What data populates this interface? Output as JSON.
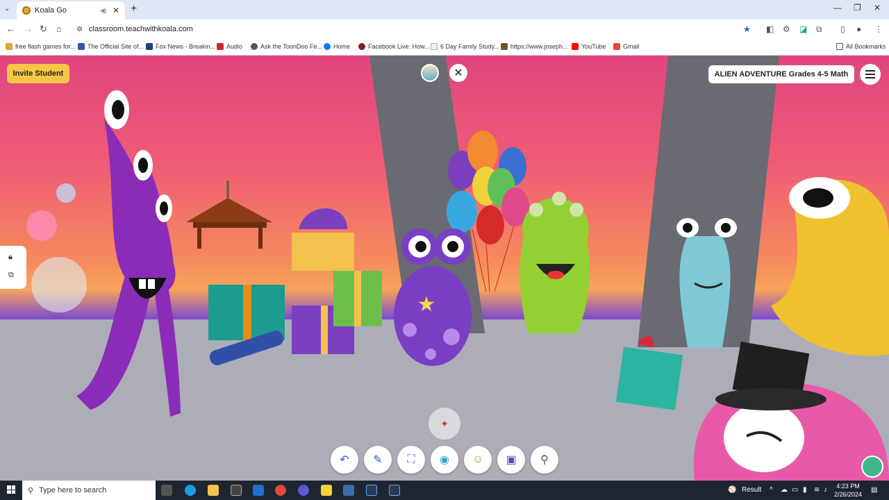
{
  "browser": {
    "tab_title": "Koala Go",
    "url": "classroom.teachwithkoala.com",
    "bookmarks": [
      "free flash games for...",
      "The Official Site of...",
      "Fox News - Breakin...",
      "Audio",
      "Ask the ToonDoo Fe...",
      "Home",
      "Facebook Live: How...",
      "6 Day Family Study...",
      "https://www.joseph...",
      "YouTube",
      "Gmail"
    ],
    "all_bookmarks": "All Bookmarks"
  },
  "app": {
    "invite_label": "Invite Student",
    "lesson_title": "ALIEN ADVENTURE Grades 4-5 Math",
    "close_glyph": "✕",
    "tools": [
      {
        "icon": "undo-icon",
        "glyph": "↶"
      },
      {
        "icon": "pencil-icon",
        "glyph": "✎"
      },
      {
        "icon": "focus-icon",
        "glyph": "⛶"
      },
      {
        "icon": "eye-icon",
        "glyph": "◉"
      },
      {
        "icon": "avatar-icon",
        "glyph": "☺"
      },
      {
        "icon": "cube-icon",
        "glyph": "▣"
      },
      {
        "icon": "pin-icon",
        "glyph": "⚲"
      }
    ],
    "accent_color": "#f7c744"
  },
  "taskbar": {
    "search_placeholder": "Type here to search",
    "weather_label": "Result",
    "time": "4:23 PM",
    "date": "2/26/2024"
  }
}
